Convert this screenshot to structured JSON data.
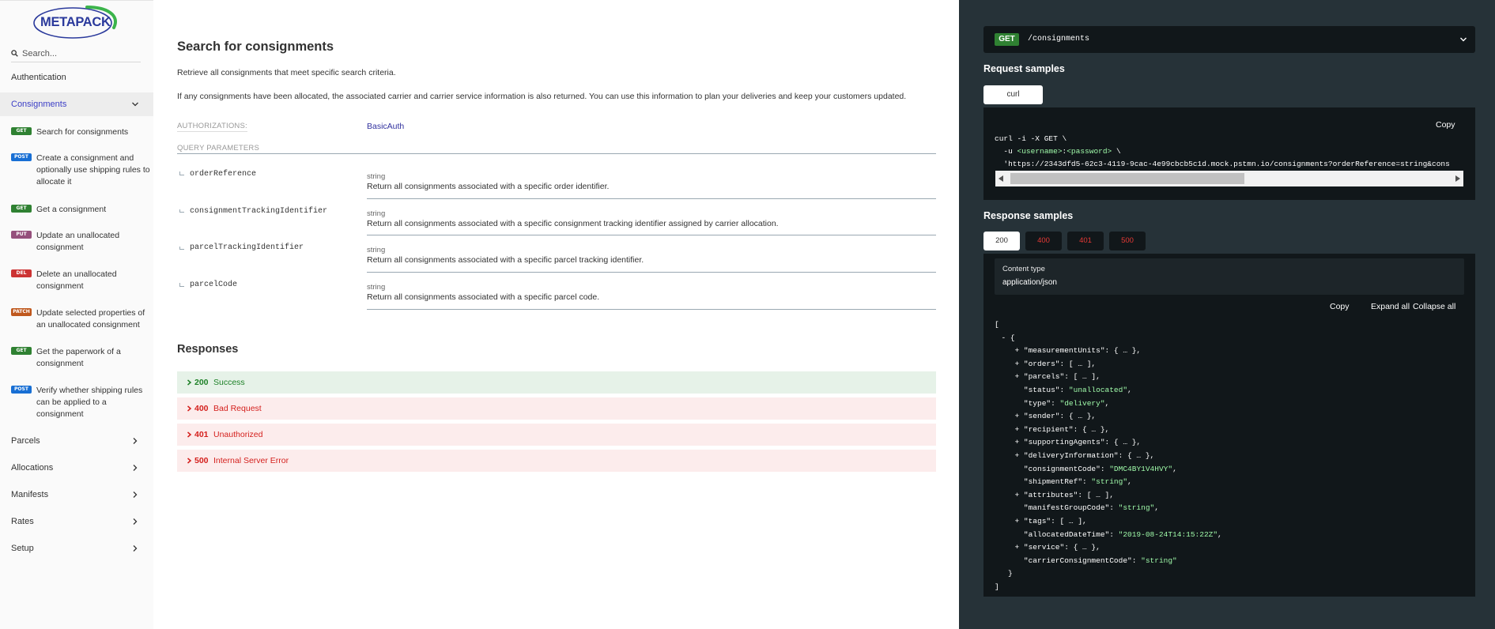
{
  "sidebar": {
    "logo_text": "METAPACK",
    "search_placeholder": "Search...",
    "top_items": [
      {
        "label": "Authentication"
      },
      {
        "label": "Consignments"
      }
    ],
    "operations": [
      {
        "method": "GET",
        "label": "Search for consignments",
        "color": "#2f8132"
      },
      {
        "method": "POST",
        "label": "Create a consignment and optionally use shipping rules to allocate it",
        "color": "#186fd4"
      },
      {
        "method": "GET",
        "label": "Get a consignment",
        "color": "#2f8132"
      },
      {
        "method": "PUT",
        "label": "Update an unallocated consignment",
        "color": "#95507c"
      },
      {
        "method": "DEL",
        "label": "Delete an unallocated consignment",
        "color": "#cc3333"
      },
      {
        "method": "PATCH",
        "label": "Update selected properties of an unallocated consignment",
        "color": "#bf581d"
      },
      {
        "method": "GET",
        "label": "Get the paperwork of a consignment",
        "color": "#2f8132"
      },
      {
        "method": "POST",
        "label": "Verify whether shipping rules can be applied to a consignment",
        "color": "#186fd4"
      }
    ],
    "bottom_items": [
      {
        "label": "Parcels"
      },
      {
        "label": "Allocations"
      },
      {
        "label": "Manifests"
      },
      {
        "label": "Rates"
      },
      {
        "label": "Setup"
      }
    ]
  },
  "main": {
    "title": "Search for consignments",
    "description_1": "Retrieve all consignments that meet specific search criteria.",
    "description_2": "If any consignments have been allocated, the associated carrier and carrier service information is also returned. You can use this information to plan your deliveries and keep your customers updated.",
    "auth_label": "AUTHORIZATIONS:",
    "auth_value": "BasicAuth",
    "query_label": "QUERY PARAMETERS",
    "params": [
      {
        "name": "orderReference",
        "type": "string",
        "description": "Return all consignments associated with a specific order identifier."
      },
      {
        "name": "consignmentTrackingIdentifier",
        "type": "string",
        "description": "Return all consignments associated with a specific consignment tracking identifier assigned by carrier allocation."
      },
      {
        "name": "parcelTrackingIdentifier",
        "type": "string",
        "description": "Return all consignments associated with a specific parcel tracking identifier."
      },
      {
        "name": "parcelCode",
        "type": "string",
        "description": "Return all consignments associated with a specific parcel code."
      }
    ],
    "responses_title": "Responses",
    "responses": [
      {
        "code": "200",
        "text": "Success"
      },
      {
        "code": "400",
        "text": "Bad Request"
      },
      {
        "code": "401",
        "text": "Unauthorized"
      },
      {
        "code": "500",
        "text": "Internal Server Error"
      }
    ]
  },
  "right": {
    "method": "GET",
    "path": "/consignments",
    "request_title": "Request samples",
    "request_tab": "curl",
    "copy_label": "Copy",
    "curl_line1": "curl -i -X GET \\",
    "curl_line2_a": "  -u ",
    "curl_line2_b": "<username>",
    "curl_line2_c": ":",
    "curl_line2_d": "<password>",
    "curl_line2_e": " \\",
    "curl_line3": "  'https://2343dfd5-62c3-4119-9cac-4e99cbcb5c1d.mock.pstmn.io/consignments?orderReference=string&cons",
    "response_title": "Response samples",
    "status_tabs": [
      "200",
      "400",
      "401",
      "500"
    ],
    "content_type_label": "Content type",
    "content_type_value": "application/json",
    "copy_all": "Copy",
    "expand_all": "Expand all",
    "collapse_all": "Collapse all",
    "json_lines": [
      {
        "indent": 0,
        "text": "["
      },
      {
        "indent": 1,
        "text": "- {"
      },
      {
        "indent": 3,
        "pre": "+ ",
        "key": "\"measurementUnits\"",
        "rest": ": { … },"
      },
      {
        "indent": 3,
        "pre": "+ ",
        "key": "\"orders\"",
        "rest": ": [ … ],"
      },
      {
        "indent": 3,
        "pre": "+ ",
        "key": "\"parcels\"",
        "rest": ": [ … ],"
      },
      {
        "indent": 3,
        "pre": "  ",
        "key": "\"status\"",
        "rest": ": ",
        "str": "\"unallocated\"",
        "end": ","
      },
      {
        "indent": 3,
        "pre": "  ",
        "key": "\"type\"",
        "rest": ": ",
        "str": "\"delivery\"",
        "end": ","
      },
      {
        "indent": 3,
        "pre": "+ ",
        "key": "\"sender\"",
        "rest": ": { … },"
      },
      {
        "indent": 3,
        "pre": "+ ",
        "key": "\"recipient\"",
        "rest": ": { … },"
      },
      {
        "indent": 3,
        "pre": "+ ",
        "key": "\"supportingAgents\"",
        "rest": ": { … },"
      },
      {
        "indent": 3,
        "pre": "+ ",
        "key": "\"deliveryInformation\"",
        "rest": ": { … },"
      },
      {
        "indent": 3,
        "pre": "  ",
        "key": "\"consignmentCode\"",
        "rest": ": ",
        "str": "\"DMC4BY1V4HVY\"",
        "end": ","
      },
      {
        "indent": 3,
        "pre": "  ",
        "key": "\"shipmentRef\"",
        "rest": ": ",
        "str": "\"string\"",
        "end": ","
      },
      {
        "indent": 3,
        "pre": "+ ",
        "key": "\"attributes\"",
        "rest": ": [ … ],"
      },
      {
        "indent": 3,
        "pre": "  ",
        "key": "\"manifestGroupCode\"",
        "rest": ": ",
        "str": "\"string\"",
        "end": ","
      },
      {
        "indent": 3,
        "pre": "+ ",
        "key": "\"tags\"",
        "rest": ": [ … ],"
      },
      {
        "indent": 3,
        "pre": "  ",
        "key": "\"allocatedDateTime\"",
        "rest": ": ",
        "str": "\"2019-08-24T14:15:22Z\"",
        "end": ","
      },
      {
        "indent": 3,
        "pre": "+ ",
        "key": "\"service\"",
        "rest": ": { … },"
      },
      {
        "indent": 3,
        "pre": "  ",
        "key": "\"carrierConsignmentCode\"",
        "rest": ": ",
        "str": "\"string\"",
        "end": ""
      },
      {
        "indent": 2,
        "text": "}"
      },
      {
        "indent": 0,
        "text": "]"
      }
    ]
  },
  "colors": {
    "accent": "#32329f",
    "sidebar_bg": "#fafafa",
    "panel_bg": "#263238",
    "code_bg": "#11171a",
    "success_bg": "#e6f2e8",
    "error_bg": "#fcecec",
    "string_green": "#a0fbaa"
  }
}
